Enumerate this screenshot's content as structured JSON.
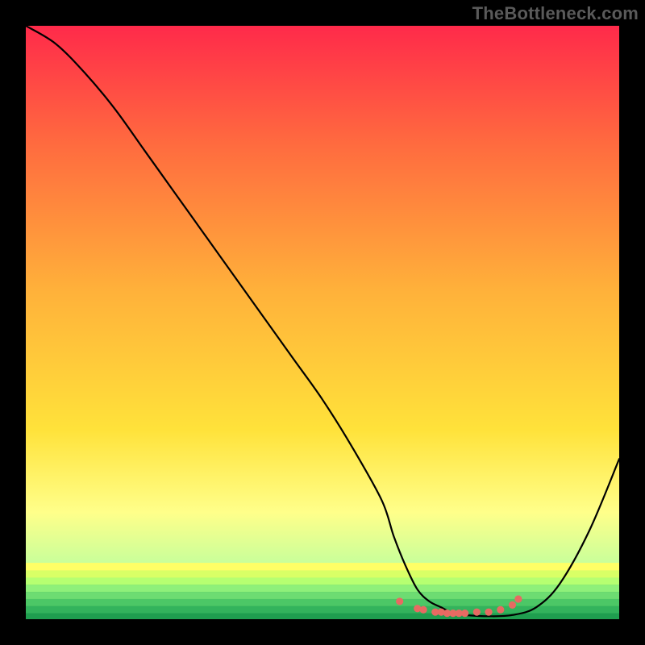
{
  "attribution": "TheBottleneck.com",
  "colors": {
    "page_bg": "#000000",
    "attribution_text": "#5a5a5a",
    "gradient_top": "#ff2a4a",
    "gradient_upper_mid": "#ff6b3f",
    "gradient_mid": "#ffb23a",
    "gradient_lower_mid": "#ffe23a",
    "gradient_yellow_pale": "#ffff8a",
    "gradient_green_pale": "#c9ff9a",
    "gradient_green": "#4dbf4d",
    "gradient_green_deep": "#1f9e4f",
    "curve_stroke": "#000000",
    "dot_fill": "#e86a62"
  },
  "chart_data": {
    "type": "line",
    "title": "",
    "xlabel": "",
    "ylabel": "",
    "xlim": [
      0,
      100
    ],
    "ylim": [
      0,
      100
    ],
    "series": [
      {
        "name": "bottleneck-curve",
        "x": [
          0,
          5,
          10,
          15,
          20,
          25,
          30,
          35,
          40,
          45,
          50,
          55,
          60,
          62,
          64,
          66,
          68,
          70,
          72,
          74,
          78,
          82,
          86,
          90,
          95,
          100
        ],
        "y": [
          100,
          97,
          92,
          86,
          79,
          72,
          65,
          58,
          51,
          44,
          37,
          29,
          20,
          14,
          9,
          5,
          3,
          2,
          1,
          0.7,
          0.5,
          0.7,
          2,
          6,
          15,
          27
        ]
      }
    ],
    "optimal_dots": {
      "x": [
        63,
        66,
        67,
        69,
        70,
        71,
        72,
        73,
        74,
        76,
        78,
        80,
        82,
        83
      ],
      "y": [
        3.0,
        1.8,
        1.6,
        1.2,
        1.2,
        1.0,
        1.0,
        1.0,
        1.0,
        1.2,
        1.2,
        1.6,
        2.4,
        3.4
      ]
    },
    "background_gradient_stops": [
      {
        "offset": 0.0,
        "color_key": "gradient_top"
      },
      {
        "offset": 0.2,
        "color_key": "gradient_upper_mid"
      },
      {
        "offset": 0.45,
        "color_key": "gradient_mid"
      },
      {
        "offset": 0.68,
        "color_key": "gradient_lower_mid"
      },
      {
        "offset": 0.82,
        "color_key": "gradient_yellow_pale"
      },
      {
        "offset": 0.905,
        "color_key": "gradient_green_pale"
      },
      {
        "offset": 0.945,
        "color_key": "gradient_green"
      },
      {
        "offset": 1.0,
        "color_key": "gradient_green_deep"
      }
    ],
    "bottom_stripes_y": [
      0.905,
      0.918,
      0.93,
      0.942,
      0.954,
      0.966,
      0.978,
      0.99
    ]
  }
}
